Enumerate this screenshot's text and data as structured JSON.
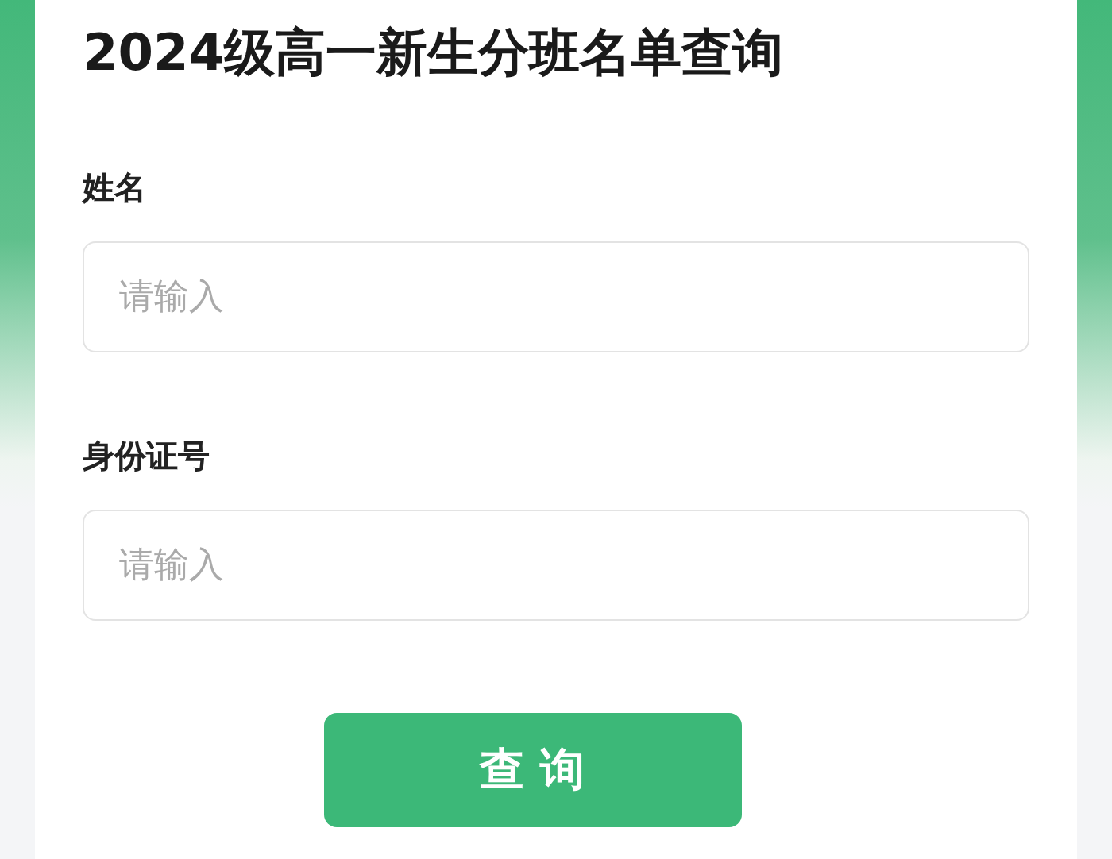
{
  "title": "2024级高一新生分班名单查询",
  "fields": [
    {
      "label": "姓名",
      "placeholder": "请输入"
    },
    {
      "label": "身份证号",
      "placeholder": "请输入"
    }
  ],
  "button": "查 询"
}
